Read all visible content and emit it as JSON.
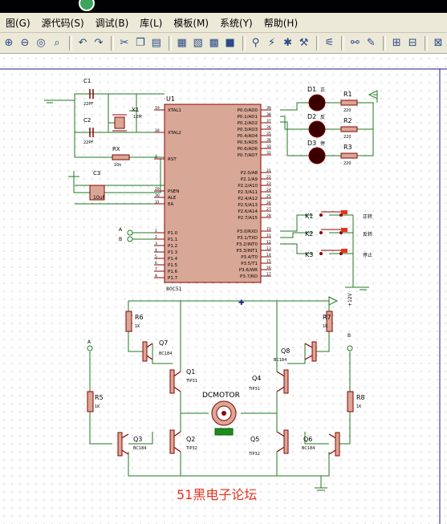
{
  "menu": [
    "图(G)",
    "源代码(S)",
    "调试(B)",
    "库(L)",
    "模板(M)",
    "系统(Y)",
    "帮助(H)"
  ],
  "toolbar": {
    "icons": [
      "zoom-in-icon",
      "zoom-out-icon",
      "zoom-fit-icon",
      "zoom-area-icon",
      "sep",
      "undo-icon",
      "redo-icon",
      "sep",
      "cut-icon",
      "copy-icon",
      "paste-icon",
      "sep",
      "block-copy-icon",
      "block-move-icon",
      "block-rotate-icon",
      "block-delete-icon",
      "sep",
      "pick-device-icon",
      "make-device-icon",
      "package-tool-icon",
      "decompose-icon",
      "sep",
      "wire-autoroute-icon",
      "sep",
      "search-icon",
      "property-assign-icon",
      "sep",
      "new-sheet-icon",
      "remove-sheet-icon",
      "sep",
      "netlist-icon"
    ]
  },
  "schematic": {
    "u1": {
      "ref": "U1",
      "part": "80C51",
      "left_pins": [
        {
          "num": "19",
          "name": "XTAL1"
        },
        {
          "num": "18",
          "name": "XTAL2"
        },
        {
          "num": "9",
          "name": "RST"
        },
        {
          "num": "29",
          "name": "PSEN"
        },
        {
          "num": "30",
          "name": "ALE"
        },
        {
          "num": "31",
          "name": "EA"
        },
        {
          "num": "1",
          "name": "P1.0"
        },
        {
          "num": "2",
          "name": "P1.1"
        },
        {
          "num": "3",
          "name": "P1.2"
        },
        {
          "num": "4",
          "name": "P1.3"
        },
        {
          "num": "5",
          "name": "P1.4"
        },
        {
          "num": "6",
          "name": "P1.5"
        },
        {
          "num": "7",
          "name": "P1.6"
        },
        {
          "num": "8",
          "name": "P1.7"
        }
      ],
      "right_pins": [
        {
          "num": "39",
          "name": "P0.0/AD0"
        },
        {
          "num": "38",
          "name": "P0.1/AD1"
        },
        {
          "num": "37",
          "name": "P0.2/AD2"
        },
        {
          "num": "36",
          "name": "P0.3/AD3"
        },
        {
          "num": "35",
          "name": "P0.4/AD4"
        },
        {
          "num": "34",
          "name": "P0.5/AD5"
        },
        {
          "num": "33",
          "name": "P0.6/AD6"
        },
        {
          "num": "32",
          "name": "P0.7/AD7"
        },
        {
          "num": "21",
          "name": "P2.0/A8"
        },
        {
          "num": "22",
          "name": "P2.1/A9"
        },
        {
          "num": "23",
          "name": "P2.2/A10"
        },
        {
          "num": "24",
          "name": "P2.3/A11"
        },
        {
          "num": "25",
          "name": "P2.4/A12"
        },
        {
          "num": "26",
          "name": "P2.5/A13"
        },
        {
          "num": "27",
          "name": "P2.6/A14"
        },
        {
          "num": "28",
          "name": "P2.7/A15"
        },
        {
          "num": "10",
          "name": "P3.0/RXD"
        },
        {
          "num": "11",
          "name": "P3.1/TXD"
        },
        {
          "num": "12",
          "name": "P3.2/INT0"
        },
        {
          "num": "13",
          "name": "P3.3/INT1"
        },
        {
          "num": "14",
          "name": "P3.4/T0"
        },
        {
          "num": "15",
          "name": "P3.5/T1"
        },
        {
          "num": "16",
          "name": "P3.6/WR"
        },
        {
          "num": "17",
          "name": "P3.7/RD"
        }
      ]
    },
    "caps": {
      "c1": "C1",
      "c1_val": "22PF",
      "c2": "C2",
      "c2_val": "22PF",
      "c3": "C3",
      "c3_val": "10uF"
    },
    "crystal": {
      "ref": "X1",
      "val": "12M"
    },
    "rx": {
      "ref": "RX",
      "val": "10k"
    },
    "leds": [
      {
        "ref": "D1",
        "note": "正"
      },
      {
        "ref": "D2",
        "note": "反"
      },
      {
        "ref": "D3",
        "note": "停"
      }
    ],
    "led_res": [
      {
        "ref": "R1",
        "val": "220"
      },
      {
        "ref": "R2",
        "val": "220"
      },
      {
        "ref": "R3",
        "val": "220"
      }
    ],
    "keys": [
      {
        "ref": "K1",
        "note": "正转"
      },
      {
        "ref": "K2",
        "note": "反转"
      },
      {
        "ref": "K3",
        "note": "停止"
      }
    ],
    "net_a": "A",
    "net_b": "B",
    "supply": "+12V",
    "bridge": {
      "r6": "R6",
      "r6_val": "1K",
      "r7": "R7",
      "r7_val": "1K",
      "r5": "R5",
      "r5_val": "1K",
      "r8": "R8",
      "r8_val": "1K",
      "q7": "Q7",
      "q7_part": "BC184",
      "q8": "Q8",
      "q8_part": "BC184",
      "q1": "Q1",
      "q1_part": "TIP31",
      "q4": "Q4",
      "q4_part": "TIP31",
      "q2": "Q2",
      "q2_part": "TIP32",
      "q5": "Q5",
      "q5_part": "TIP32",
      "q3": "Q3",
      "q3_part": "BC184",
      "q6": "Q6",
      "q6_part": "BC184",
      "motor": "DCMOTOR"
    },
    "watermark": "51黑电子论坛"
  },
  "colors": {
    "wire": "#1d7a1d",
    "component": "#8b0000",
    "body": "#d9a795",
    "led_off": "#3a0000",
    "watermark": "#e8311f",
    "canvas_bg": "#ffffff",
    "menu_bg": "#ece9d8"
  }
}
